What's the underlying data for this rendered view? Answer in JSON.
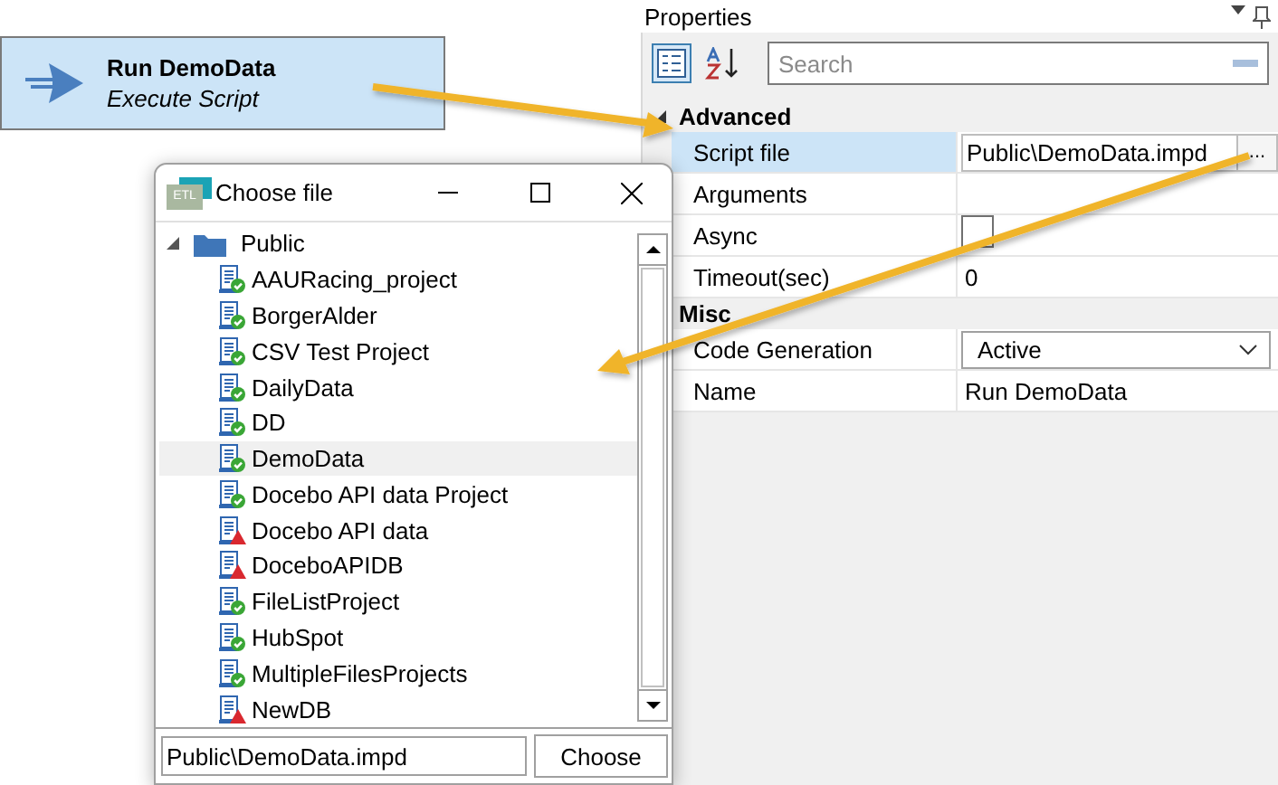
{
  "node": {
    "title": "Run DemoData",
    "subtitle": "Execute Script"
  },
  "properties": {
    "title": "Properties",
    "search": {
      "placeholder": "Search"
    },
    "categories": [
      {
        "name": "Advanced",
        "expanded": true,
        "rows": [
          {
            "name": "Script file",
            "kind": "text",
            "value": "Public\\DemoData.impd",
            "button": "...",
            "selected": true
          },
          {
            "name": "Arguments",
            "kind": "text",
            "selected": false
          },
          {
            "name": "Async",
            "kind": "checkbox",
            "checked": false,
            "selected": false
          },
          {
            "name": "Timeout(sec)",
            "kind": "text",
            "value": "0",
            "selected": false
          }
        ]
      },
      {
        "name": "Misc",
        "rows": [
          {
            "name": "Code Generation",
            "kind": "dropdown",
            "value": "Active",
            "selected": false
          },
          {
            "name": "Name",
            "kind": "text",
            "value": "Run DemoData",
            "selected": false
          }
        ]
      }
    ]
  },
  "dialog": {
    "title": "Choose file",
    "app_icon": "ETL",
    "tree": {
      "name": "Public",
      "expanded": true,
      "children": [
        {
          "name": "AAURacing_project",
          "kind": "ok",
          "selected": false
        },
        {
          "name": "BorgerAlder",
          "kind": "ok",
          "selected": false
        },
        {
          "name": "CSV Test Project",
          "kind": "ok",
          "selected": false
        },
        {
          "name": "DailyData",
          "kind": "ok",
          "selected": false
        },
        {
          "name": "DD",
          "kind": "ok",
          "selected": false
        },
        {
          "name": "DemoData",
          "kind": "ok",
          "selected": true
        },
        {
          "name": "Docebo API data Project",
          "kind": "ok",
          "selected": false
        },
        {
          "name": "Docebo API data",
          "kind": "warning",
          "selected": false
        },
        {
          "name": "DoceboAPIDB",
          "kind": "warning",
          "selected": false
        },
        {
          "name": "FileListProject",
          "kind": "ok",
          "selected": false
        },
        {
          "name": "HubSpot",
          "kind": "ok",
          "selected": false
        },
        {
          "name": "MultipleFilesProjects",
          "kind": "ok",
          "selected": false
        },
        {
          "name": "NewDB",
          "kind": "warning",
          "selected": false
        }
      ]
    },
    "path": {
      "value": "Public\\DemoData.impd"
    },
    "button": "Choose"
  }
}
